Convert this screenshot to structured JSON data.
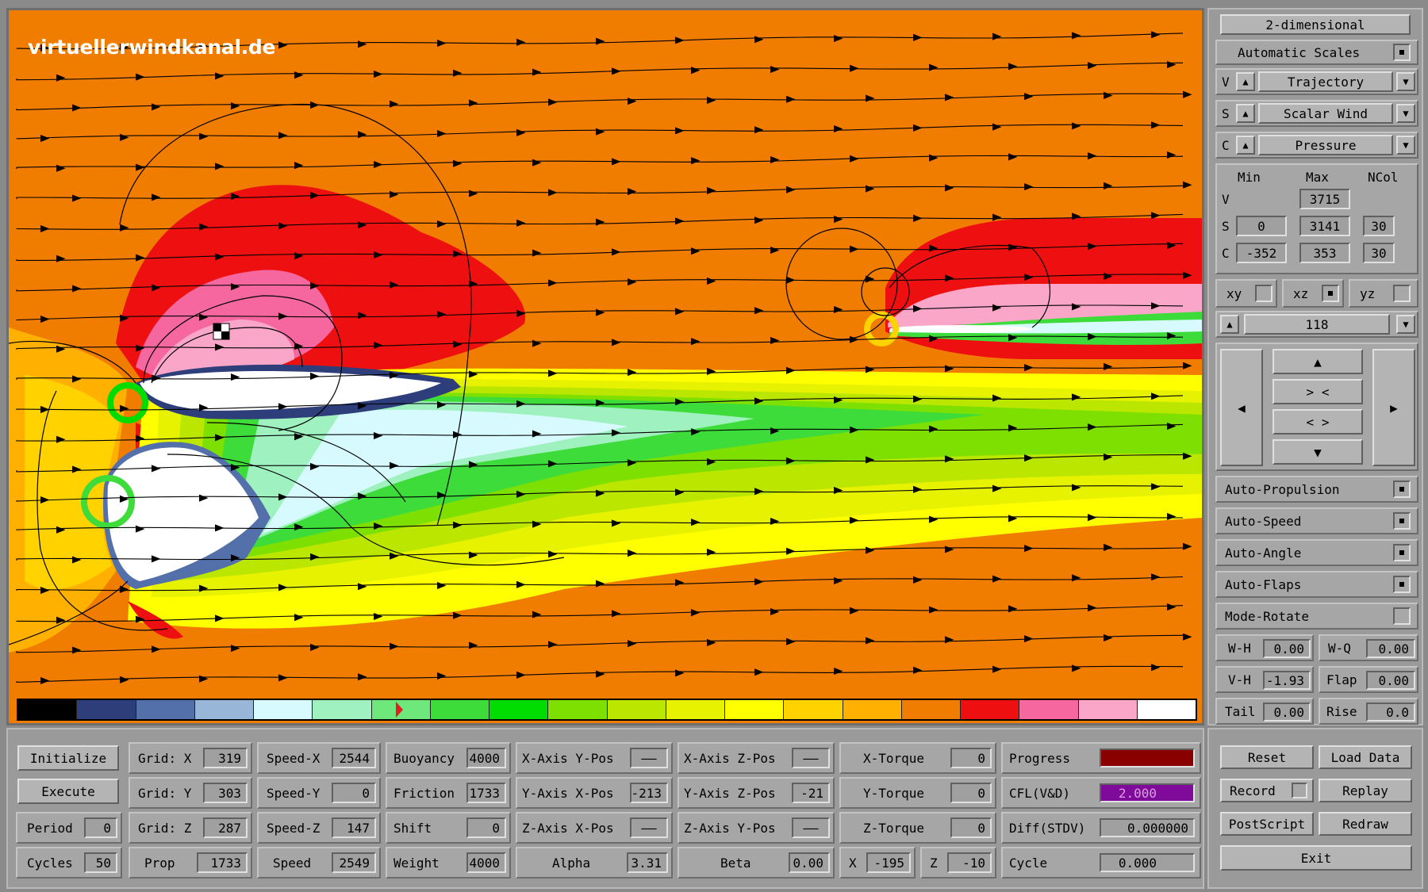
{
  "logo": "virtuellerwindkanal.de",
  "colors": {
    "background_field": "#f07c00",
    "colorbar": [
      "#000000",
      "#2e3e7a",
      "#5470ab",
      "#97b6d8",
      "#d7faff",
      "#9ff2bf",
      "#6ee87a",
      "#3ddc3a",
      "#00dc00",
      "#7ee000",
      "#bbe600",
      "#e7f200",
      "#ffff00",
      "#ffd200",
      "#ffb000",
      "#f07c00",
      "#ee1010",
      "#f5679e",
      "#f9a6c8",
      "#ffffff"
    ],
    "progress_fill": "#8a0000",
    "cfl_fill": "#800a9a"
  },
  "right_panel": {
    "mode_button": "2-dimensional",
    "auto_scales": "Automatic Scales",
    "v_row": {
      "key": "V",
      "value": "Trajectory"
    },
    "s_row": {
      "key": "S",
      "value": "Scalar Wind"
    },
    "c_row": {
      "key": "C",
      "value": "Pressure"
    },
    "headers": {
      "min": "Min",
      "max": "Max",
      "ncol": "NCol"
    },
    "scales": {
      "v": {
        "key": "V",
        "max": "3715"
      },
      "s": {
        "key": "S",
        "min": "0",
        "max": "3141",
        "ncol": "30"
      },
      "c": {
        "key": "C",
        "min": "-352",
        "max": "353",
        "ncol": "30"
      }
    },
    "planes": {
      "xy": "xy",
      "xz": "xz",
      "yz": "yz"
    },
    "slice": "118",
    "nav": {
      "up": "▲",
      "zoom_in": "> <",
      "zoom_out": "< >",
      "down": "▼",
      "left": "◀",
      "right": "▶"
    },
    "toggles": {
      "auto_propulsion": "Auto-Propulsion",
      "auto_speed": "Auto-Speed",
      "auto_angle": "Auto-Angle",
      "auto_flaps": "Auto-Flaps",
      "mode_rotate": "Mode-Rotate"
    },
    "params": {
      "wh": {
        "label": "W-H",
        "value": "0.00"
      },
      "wq": {
        "label": "W-Q",
        "value": "0.00"
      },
      "vh": {
        "label": "V-H",
        "value": "-1.93"
      },
      "flap": {
        "label": "Flap",
        "value": "0.00"
      },
      "tail": {
        "label": "Tail",
        "value": "0.00"
      },
      "rise": {
        "label": "Rise",
        "value": "0.0"
      }
    }
  },
  "bottom": {
    "initialize": "Initialize",
    "execute": "Execute",
    "period": {
      "label": "Period",
      "value": "0"
    },
    "cycles": {
      "label": "Cycles",
      "value": "50"
    },
    "gridx": {
      "label": "Grid: X",
      "value": "319"
    },
    "gridy": {
      "label": "Grid: Y",
      "value": "303"
    },
    "gridz": {
      "label": "Grid: Z",
      "value": "287"
    },
    "prop": {
      "label": "Prop",
      "value": "1733"
    },
    "speedx": {
      "label": "Speed-X",
      "value": "2544"
    },
    "speedy": {
      "label": "Speed-Y",
      "value": "0"
    },
    "speedz": {
      "label": "Speed-Z",
      "value": "147"
    },
    "speed": {
      "label": "Speed",
      "value": "2549"
    },
    "buoyancy": {
      "label": "Buoyancy",
      "value": "4000"
    },
    "friction": {
      "label": "Friction",
      "value": "1733"
    },
    "shift": {
      "label": "Shift",
      "value": "0"
    },
    "weight": {
      "label": "Weight",
      "value": "4000"
    },
    "xaxis_ypos": {
      "label": "X-Axis Y-Pos",
      "value": "——"
    },
    "yaxis_xpos": {
      "label": "Y-Axis X-Pos",
      "value": "-213"
    },
    "zaxis_xpos": {
      "label": "Z-Axis X-Pos",
      "value": "——"
    },
    "alpha": {
      "label": "Alpha",
      "value": "3.31"
    },
    "xaxis_zpos": {
      "label": "X-Axis Z-Pos",
      "value": "——"
    },
    "yaxis_zpos": {
      "label": "Y-Axis Z-Pos",
      "value": "-21"
    },
    "zaxis_ypos": {
      "label": "Z-Axis Y-Pos",
      "value": "——"
    },
    "beta": {
      "label": "Beta",
      "value": "0.00"
    },
    "xtorque": {
      "label": "X-Torque",
      "value": "0"
    },
    "ytorque": {
      "label": "Y-Torque",
      "value": "0"
    },
    "ztorque": {
      "label": "Z-Torque",
      "value": "0"
    },
    "x": {
      "label": "X",
      "value": "-195"
    },
    "z": {
      "label": "Z",
      "value": "-10"
    },
    "progress": {
      "label": "Progress",
      "value": 1.0
    },
    "cfl": {
      "label": "CFL(V&D)",
      "value": "2.000"
    },
    "diff": {
      "label": "Diff(STDV)",
      "value": "0.000000"
    },
    "cycle": {
      "label": "Cycle",
      "value": "0.000"
    },
    "reset": "Reset",
    "load_data": "Load Data",
    "record": "Record",
    "replay": "Replay",
    "postscript": "PostScript",
    "redraw": "Redraw",
    "exit": "Exit"
  }
}
